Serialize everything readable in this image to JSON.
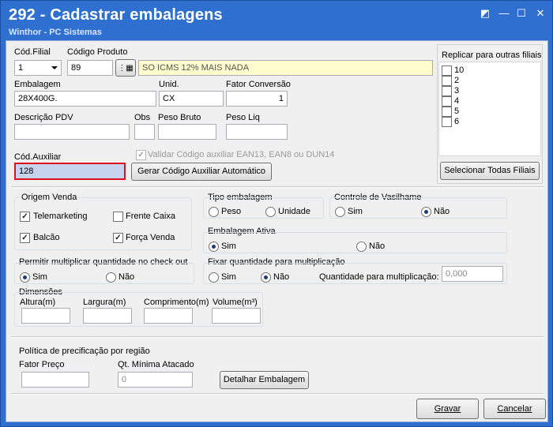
{
  "window": {
    "title": "292 - Cadastrar embalagens",
    "subtitle": "Winthor - PC Sistemas",
    "controls": {
      "restore": "◩",
      "minimize": "—",
      "maximize": "☐",
      "close": "✕"
    }
  },
  "form": {
    "cod_filial": {
      "label": "Cód.Filial",
      "value": "1"
    },
    "codigo_produto": {
      "label": "Código Produto",
      "value": "89",
      "description": "SO ICMS 12% MAIS NADA"
    },
    "embalagem": {
      "label": "Embalagem",
      "value": "28X400G."
    },
    "unid": {
      "label": "Unid.",
      "value": "CX"
    },
    "fator_conversao": {
      "label": "Fator Conversão",
      "value": "1"
    },
    "descricao_pdv": {
      "label": "Descrição PDV",
      "value": ""
    },
    "obs": {
      "label": "Obs",
      "value": ""
    },
    "peso_bruto": {
      "label": "Peso Bruto",
      "value": ""
    },
    "peso_liq": {
      "label": "Peso Liq",
      "value": ""
    },
    "cod_auxiliar": {
      "label": "Cód.Auxiliar",
      "value": "128"
    },
    "validar_codigo": {
      "label": "Validar Código auxiliar EAN13, EAN8 ou DUN14",
      "checked": true
    },
    "gerar_button": "Gerar Código Auxiliar Automático"
  },
  "replicar": {
    "title": "Replicar para outras filiais",
    "items": [
      "10",
      "2",
      "3",
      "4",
      "5",
      "6"
    ],
    "select_all_button": "Selecionar Todas Filiais"
  },
  "origem_venda": {
    "title": "Origem Venda",
    "telemarketing": "Telemarketing",
    "frente_caixa": "Frente Caixa",
    "balcao": "Balcão",
    "forca_venda": "Força Venda"
  },
  "tipo_embalagem": {
    "title": "Tipo embalagem",
    "peso": "Peso",
    "unidade": "Unidade"
  },
  "controle_vasilhame": {
    "title": "Controle de Vasilhame",
    "sim": "Sim",
    "nao": "Não"
  },
  "embalagem_ativa": {
    "title": "Embalagem Ativa",
    "sim": "Sim",
    "nao": "Não"
  },
  "permitir_multiplicar": {
    "title": "Permitir multiplicar quantidade no check out",
    "sim": "Sim",
    "nao": "Não"
  },
  "fixar_quantidade": {
    "title": "Fixar quantidade para multiplicação",
    "sim": "Sim",
    "nao": "Não",
    "qtd_label": "Quantidade para multiplicação:",
    "qtd_value": "0,000"
  },
  "dimensoes": {
    "title": "Dimensões",
    "altura": "Altura(m)",
    "largura": "Largura(m)",
    "comprimento": "Comprimento(m)",
    "volume": "Volume(m³)"
  },
  "politica": {
    "title": "Política de precificação por região",
    "fator_preco": "Fator Preço",
    "qt_minima": "Qt. Mínima Atacado",
    "qt_minima_value": "0",
    "detalhar_button": "Detalhar Embalagem"
  },
  "footer": {
    "gravar": "Gravar",
    "cancelar": "Cancelar"
  },
  "colors": {
    "title_bar": "#2f6fd0",
    "highlight_field": "#c5d3ec",
    "highlight_border": "#e0101a",
    "description_bg": "#fffccd"
  }
}
